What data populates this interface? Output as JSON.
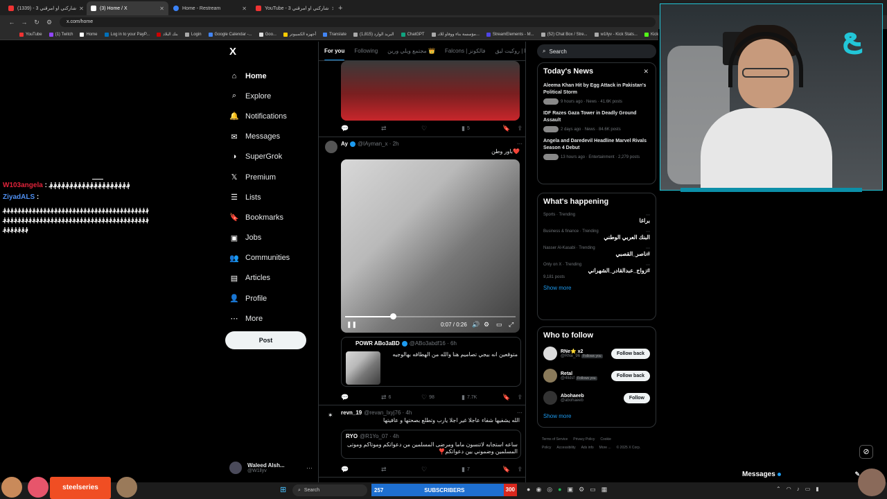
{
  "browser": {
    "tabs": [
      {
        "label": "شاركني او امرقني 3 - (1339)",
        "color": "#e33"
      },
      {
        "label": "(3) Home / X",
        "color": "#fff",
        "active": true
      },
      {
        "label": "Home - Restream",
        "color": "#3b82f6"
      },
      {
        "label": "YouTube - شاركني او امرقني 3",
        "color": "#e33"
      }
    ],
    "url": "x.com/home",
    "bookmarks": [
      "YouTube",
      "(1) Twitch",
      "Home",
      "Log in to your PayP...",
      "بنك البلاد",
      "Login",
      "Google Calendar -...",
      "Goo...",
      "أجهزة الكمبيوتر",
      "Translate",
      "البريد الوارد (1,815)",
      "ChatGPT",
      "مؤسسة بناء ووفاو للاتـ...",
      "StreamElements - M...",
      "(52) Chat Box / Stre...",
      "w1llyv - Kick Stats...",
      "Kick"
    ]
  },
  "chat": {
    "messages": [
      {
        "user": "W103angela",
        "text": "؋؋؋؋؋؋؋؋؋؋؋؋؋؋؋؋؋؋؋؋"
      },
      {
        "user": "ZiyadALS",
        "text": ""
      }
    ],
    "block": "؋؋؋؋؋؋؋؋؋؋؋؋؋؋؋؋؋؋؋؋؋؋؋؋؋؋؋؋؋؋؋؋؋؋؋؋؋؋؋؋؋؋؋؋؋؋؋؋؋؋؋؋؋؋؋؋؋؋؋؋؋؋؋؋؋؋؋؋؋؋؋؋؋؋؋؋؋؋؋؋؋؋؋؋؋؋؋"
  },
  "sidebar": {
    "logo": "X",
    "items": [
      {
        "label": "Home",
        "icon": "⌂",
        "name": "home"
      },
      {
        "label": "Explore",
        "icon": "⌕",
        "name": "explore"
      },
      {
        "label": "Notifications",
        "icon": "🔔",
        "name": "notifications"
      },
      {
        "label": "Messages",
        "icon": "✉",
        "name": "messages"
      },
      {
        "label": "SuperGrok",
        "icon": "◑",
        "name": "supergrok"
      },
      {
        "label": "Premium",
        "icon": "𝕏",
        "name": "premium"
      },
      {
        "label": "Lists",
        "icon": "☰",
        "name": "lists"
      },
      {
        "label": "Bookmarks",
        "icon": "🔖",
        "name": "bookmarks"
      },
      {
        "label": "Jobs",
        "icon": "▣",
        "name": "jobs"
      },
      {
        "label": "Communities",
        "icon": "👥",
        "name": "communities"
      },
      {
        "label": "Articles",
        "icon": "▤",
        "name": "articles"
      },
      {
        "label": "Profile",
        "icon": "👤",
        "name": "profile"
      },
      {
        "label": "More",
        "icon": "⋯",
        "name": "more"
      }
    ],
    "post_button": "Post",
    "account": {
      "name": "Waleed Alsh...",
      "handle": "@W1llyv"
    }
  },
  "timeline": {
    "tabs": [
      "For you",
      "Following",
      "مجتمع ويلي ورين 👑",
      "Falcons | فالكونز",
      "روكيت ليق | RL"
    ],
    "post1": {
      "stats": {
        "replies": "",
        "reposts": "",
        "likes": "",
        "views": "5"
      }
    },
    "post2": {
      "name": "Ay",
      "handle": "@IAyman_x",
      "time": "2h",
      "text": "❤️باور وطن",
      "video_time": "0:07 / 0:26",
      "video_progress": 0.28,
      "quote": {
        "name": "POWR ABo3aBD",
        "handle": "@ABo3abdf16",
        "time": "6h",
        "text": "متوقعين انه بيجي تصاميم هنا والله من الهطافه بهالوجيه"
      },
      "stats": {
        "replies": "",
        "reposts": "6",
        "likes": "98",
        "views": "7.7K"
      }
    },
    "post3": {
      "name": "revn_19",
      "handle": "@revan_lxyj76",
      "time": "4h",
      "text": "الله يشفيها شفاء عاجلا غير اجلا يارب وتطلع بصحتها و عافيتها",
      "quote": {
        "name": "RYO",
        "handle": "@R1Yo_07",
        "time": "4h",
        "text": "ساعه استجابه لاتنسون ماما ومرضى المسلمين من دعواتكم وموتاكم وموتى المسلمين وضموني بين دعواتكم❣️"
      },
      "stats": {
        "replies": "",
        "reposts": "",
        "likes": "7",
        "views": ""
      }
    }
  },
  "right": {
    "search_placeholder": "Search",
    "news": {
      "title": "Today's News",
      "items": [
        {
          "title": "Aleema Khan Hit by Egg Attack in Pakistan's Political Storm",
          "meta": "9 hours ago · News · 41.6K posts"
        },
        {
          "title": "IDF Razes Gaza Tower in Deadly Ground Assault",
          "meta": "2 days ago · News · 84.6K posts"
        },
        {
          "title": "Angela and Daredevil Headline Marvel Rivals Season 4 Debut",
          "meta": "13 hours ago · Entertainment · 2,279 posts"
        }
      ]
    },
    "happening": {
      "title": "What's happening",
      "items": [
        {
          "cat": "Sports · Trending",
          "name": "براغا",
          "count": ""
        },
        {
          "cat": "Business & finance · Trending",
          "name": "البنك العربي الوطني",
          "count": ""
        },
        {
          "cat": "Nasser Al-Kasabi · Trending",
          "name": "#ناصر_القصبي",
          "count": ""
        },
        {
          "cat": "Only on X · Trending",
          "name": "#زواج_عبدالقادر_الشهراني",
          "count": "9,181 posts"
        }
      ],
      "show_more": "Show more"
    },
    "who_to_follow": {
      "title": "Who to follow",
      "items": [
        {
          "name": "RNe⭐ x2",
          "handle": "@RNe_96",
          "follows_you": "Follows you",
          "button": "Follow back"
        },
        {
          "name": "Retal",
          "handle": "@4lldsf",
          "follows_you": "Follows you",
          "button": "Follow back"
        },
        {
          "name": "Abohaeeb",
          "handle": "@abohaeeb",
          "follows_you": "",
          "button": "Follow"
        }
      ],
      "show_more": "Show more"
    },
    "footer": [
      "Terms of Service",
      "Privacy Policy",
      "Cookie Policy",
      "Accessibility",
      "Ads info",
      "More ...",
      "© 2025 X Corp."
    ]
  },
  "messages_drawer": {
    "label": "Messages"
  },
  "taskbar": {
    "search": "Search",
    "sponsor": "steelseries",
    "subs_current": "257",
    "subs_label": "SUBSCRIBERS",
    "subs_goal": "300"
  },
  "colors": {
    "accent": "#1d9bf0",
    "chat_user1": "#e0233a",
    "chat_user2": "#4f8ff0",
    "steelseries": "#f04e23",
    "subs_bar": "#1e6fd0"
  }
}
